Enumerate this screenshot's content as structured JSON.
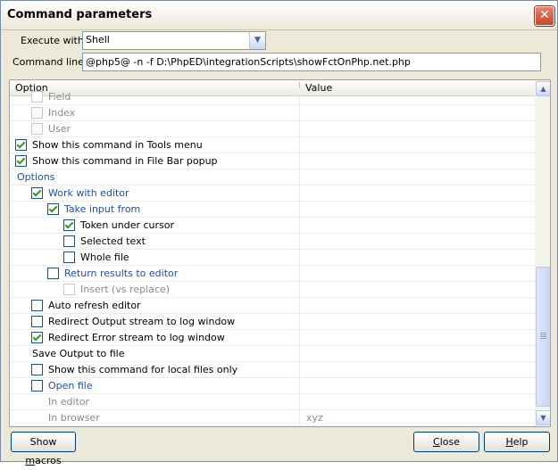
{
  "window": {
    "title": "Command parameters",
    "close_symbol": "✕"
  },
  "form": {
    "execute_label": "Execute with:",
    "execute_value": "Shell",
    "cmdline_label": "Command line:",
    "cmdline_value": "@php5@ -n -f D:\\PhpED\\integrationScripts\\showFctOnPhp.net.php"
  },
  "grid": {
    "col_option": "Option",
    "col_value": "Value",
    "rows": [
      {
        "label": "Field",
        "check": "unchecked",
        "style": "gray",
        "disabled": true,
        "value": ""
      },
      {
        "label": "Index",
        "check": "unchecked",
        "style": "gray",
        "disabled": true,
        "value": ""
      },
      {
        "label": "User",
        "check": "unchecked",
        "style": "gray",
        "disabled": true,
        "value": ""
      },
      {
        "label": "Show this command in Tools menu",
        "check": "checked",
        "style": "normal",
        "disabled": false,
        "value": ""
      },
      {
        "label": "Show this command in File Bar popup",
        "check": "checked",
        "style": "normal",
        "disabled": false,
        "value": ""
      },
      {
        "label": "Options",
        "check": "none",
        "style": "blue",
        "disabled": false,
        "value": ""
      },
      {
        "label": "Work with editor",
        "check": "checked",
        "style": "blue",
        "disabled": false,
        "value": ""
      },
      {
        "label": "Take input from",
        "check": "checked",
        "style": "blue",
        "disabled": false,
        "value": ""
      },
      {
        "label": "Token under cursor",
        "check": "checked",
        "style": "normal",
        "disabled": false,
        "value": ""
      },
      {
        "label": "Selected text",
        "check": "unchecked",
        "style": "normal",
        "disabled": false,
        "value": ""
      },
      {
        "label": "Whole file",
        "check": "unchecked",
        "style": "normal",
        "disabled": false,
        "value": ""
      },
      {
        "label": "Return results to editor",
        "check": "unchecked",
        "style": "blue",
        "disabled": false,
        "value": ""
      },
      {
        "label": "Insert (vs replace)",
        "check": "unchecked",
        "style": "gray",
        "disabled": true,
        "value": ""
      },
      {
        "label": "Auto refresh editor",
        "check": "unchecked",
        "style": "normal",
        "disabled": false,
        "value": ""
      },
      {
        "label": "Redirect Output stream to log window",
        "check": "unchecked",
        "style": "normal",
        "disabled": false,
        "value": ""
      },
      {
        "label": "Redirect Error stream to log window",
        "check": "checked",
        "style": "normal",
        "disabled": false,
        "value": ""
      },
      {
        "label": "Save Output to file",
        "check": "none",
        "style": "normal",
        "disabled": false,
        "value": ""
      },
      {
        "label": "Show this command for local files only",
        "check": "unchecked",
        "style": "normal",
        "disabled": false,
        "value": ""
      },
      {
        "label": "Open file",
        "check": "unchecked",
        "style": "blue",
        "disabled": false,
        "value": ""
      },
      {
        "label": "In editor",
        "check": "none",
        "style": "gray",
        "disabled": true,
        "value": ""
      },
      {
        "label": "In browser",
        "check": "none",
        "style": "gray",
        "disabled": true,
        "value": "xyz"
      }
    ]
  },
  "buttons": {
    "show_macros": "Show macros",
    "close": "Close",
    "help": "Help"
  }
}
